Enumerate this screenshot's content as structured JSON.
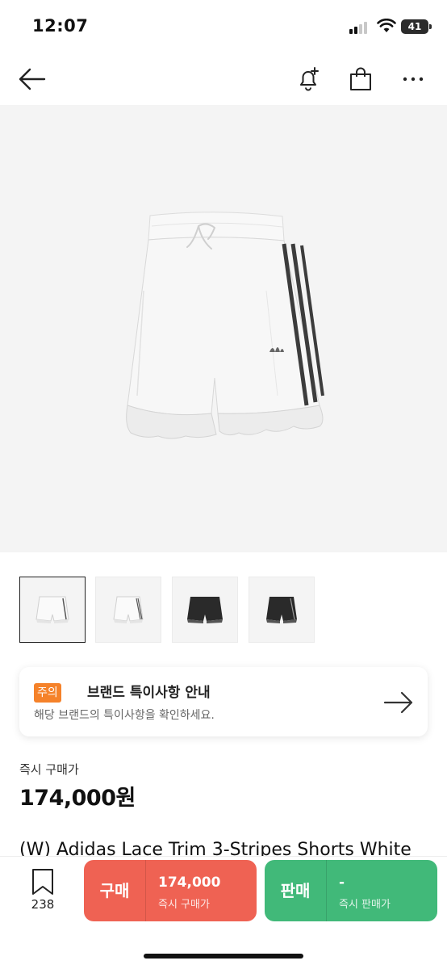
{
  "status_bar": {
    "time": "12:07",
    "battery": "41"
  },
  "nav": {
    "back_icon": "arrow-left-icon",
    "alert_icon": "bell-plus-icon",
    "cart_icon": "shopping-bag-icon",
    "more_icon": "more-horizontal-icon"
  },
  "product": {
    "image_icon": "shorts-white-image",
    "thumbnails": [
      {
        "variant": "white",
        "selected": true
      },
      {
        "variant": "white",
        "selected": false
      },
      {
        "variant": "black",
        "selected": false
      },
      {
        "variant": "black",
        "selected": false
      }
    ],
    "title": "(W) Adidas Lace Trim 3-Stripes Shorts White"
  },
  "notice": {
    "badge": "주의",
    "title": "브랜드 특이사항 안내",
    "description": "해당 브랜드의 특이사항을 확인하세요."
  },
  "price": {
    "label": "즉시 구매가",
    "value": "174,000원"
  },
  "bottom_bar": {
    "wish_count": "238",
    "buy": {
      "label": "구매",
      "price": "174,000",
      "sub": "즉시 구매가"
    },
    "sell": {
      "label": "판매",
      "price": "-",
      "sub": "즉시 판매가"
    }
  },
  "colors": {
    "buy": "#ef6253",
    "sell": "#41b979",
    "notice_badge": "#f5822a"
  }
}
